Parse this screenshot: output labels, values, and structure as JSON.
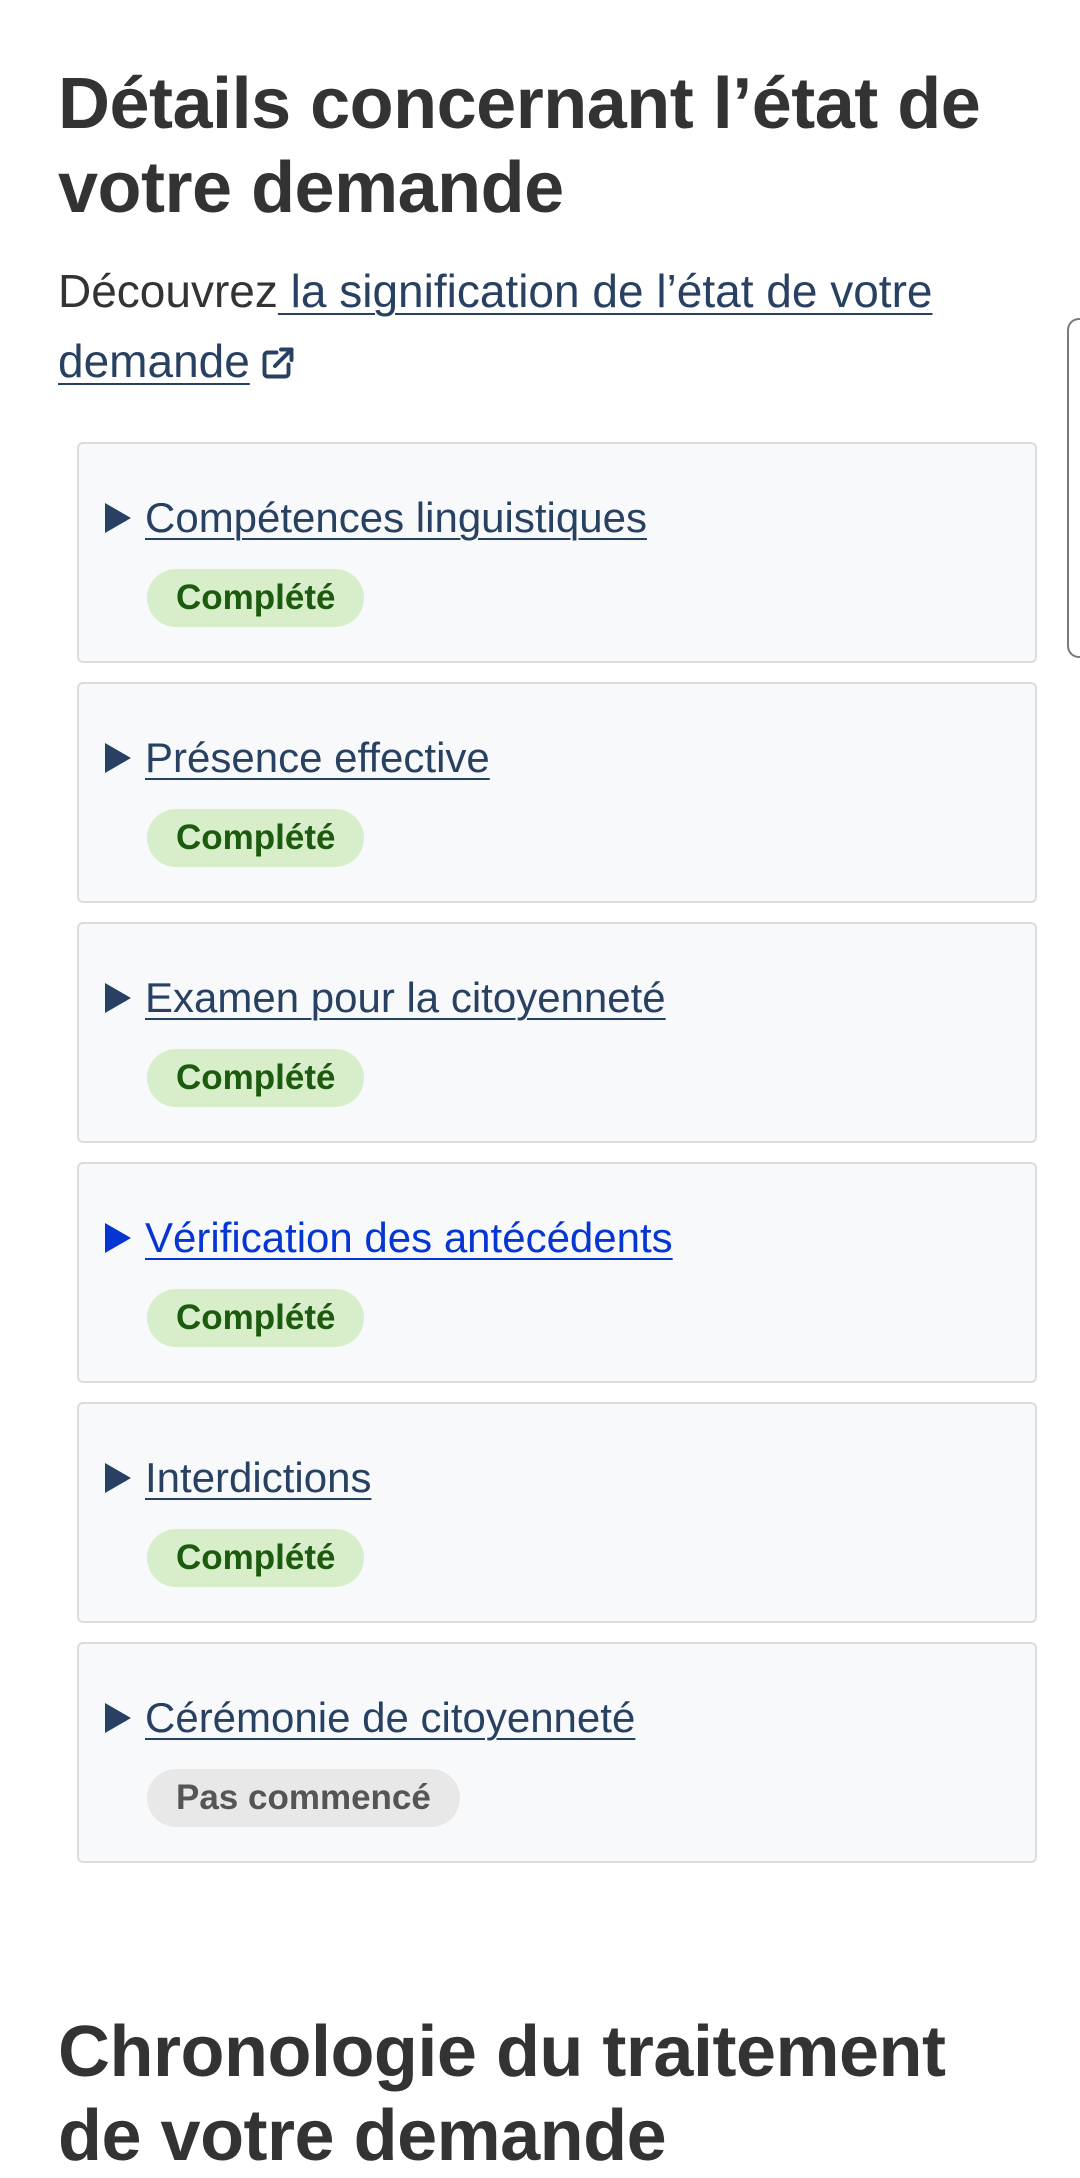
{
  "details": {
    "title": "Détails concernant l’état de votre demande",
    "intro_text": "Découvrez",
    "intro_link": " la signification de l’état de votre demande",
    "link_icon": "external-link-icon"
  },
  "panels": [
    {
      "label": "Compétences linguistiques",
      "status": "Complété",
      "status_type": "done"
    },
    {
      "label": "Présence effective",
      "status": "Complété",
      "status_type": "done"
    },
    {
      "label": "Examen pour la citoyenneté",
      "status": "Complété",
      "status_type": "done"
    },
    {
      "label": "Vérification des antécédents",
      "status": "Complété",
      "status_type": "done"
    },
    {
      "label": "Interdictions",
      "status": "Complété",
      "status_type": "done"
    },
    {
      "label": "Cérémonie de citoyenneté",
      "status": "Pas commencé",
      "status_type": "pending"
    }
  ],
  "timeline": {
    "title": "Chronologie du traitement de votre demande"
  },
  "colors": {
    "link": "#284162",
    "link_active": "#0535d2",
    "badge_done_bg": "#d8eeca",
    "badge_done_text": "#1c5a0e",
    "badge_pending_bg": "#e8e8e8",
    "badge_pending_text": "#555555"
  }
}
